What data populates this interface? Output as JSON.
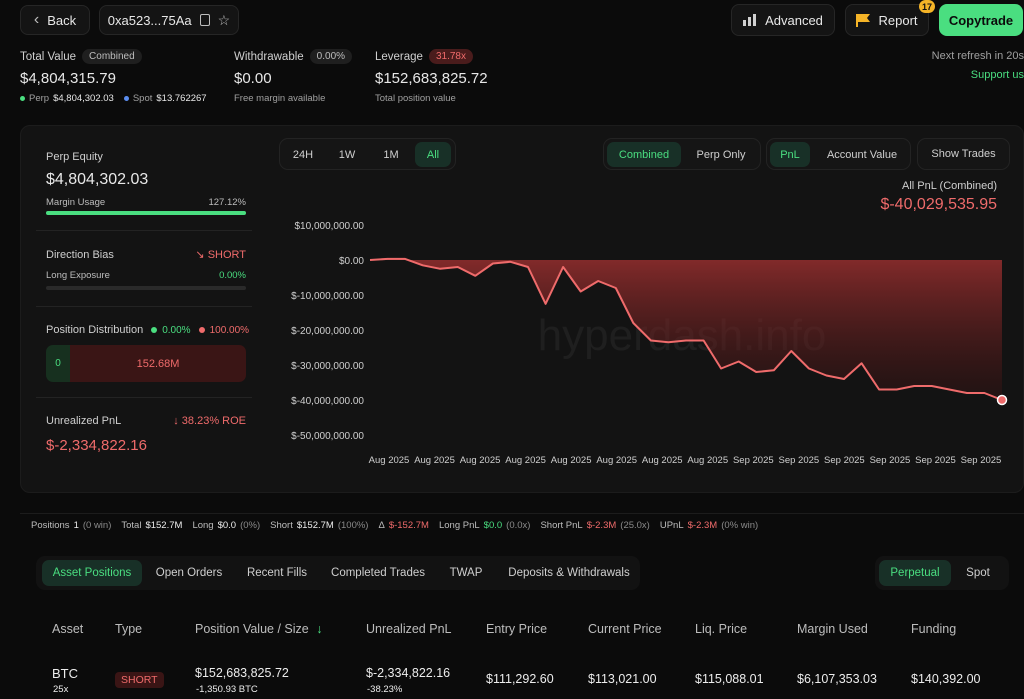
{
  "header": {
    "back_label": "Back",
    "address": "0xa523...75Aa",
    "advanced_label": "Advanced",
    "report_label": "Report",
    "report_badge": "17",
    "copytrade_label": "Copytrade",
    "refresh_text": "Next refresh in 20s",
    "support_text": "Support us"
  },
  "summary": {
    "total_value_label": "Total Value",
    "total_value_pill": "Combined",
    "total_value": "$4,804,315.79",
    "perp_label": "Perp",
    "perp_value": "$4,804,302.03",
    "spot_label": "Spot",
    "spot_value": "$13.762267",
    "withdrawable_label": "Withdrawable",
    "withdrawable_pill": "0.00%",
    "withdrawable_value": "$0.00",
    "withdrawable_sub": "Free margin available",
    "leverage_label": "Leverage",
    "leverage_pill": "31.78x",
    "leverage_value": "$152,683,825.72",
    "leverage_sub": "Total position value"
  },
  "left_panel": {
    "perp_equity_label": "Perp Equity",
    "perp_equity_value": "$4,804,302.03",
    "margin_usage_label": "Margin Usage",
    "margin_usage_value": "127.12%",
    "margin_usage_fraction": 1.0,
    "direction_bias_label": "Direction Bias",
    "direction_bias_value": "SHORT",
    "long_exposure_label": "Long Exposure",
    "long_exposure_value": "0.00%",
    "position_distribution_label": "Position Distribution",
    "dist_long_pct": "0.00%",
    "dist_short_pct": "100.00%",
    "dist_long_value": "0",
    "dist_short_value": "152.68M",
    "unrealized_pnl_label": "Unrealized PnL",
    "unrealized_roe": "38.23% ROE",
    "unrealized_pnl_value": "$-2,334,822.16"
  },
  "chart_controls": {
    "ranges": [
      "24H",
      "1W",
      "1M",
      "All"
    ],
    "active_range": "All",
    "modes": [
      "Combined",
      "Perp Only"
    ],
    "active_mode": "Combined",
    "metrics": [
      "PnL",
      "Account Value"
    ],
    "active_metric": "PnL",
    "show_trades_label": "Show Trades",
    "pnl_caption": "All PnL (Combined)",
    "pnl_total": "$-40,029,535.95",
    "watermark": "hyperdash.info"
  },
  "chart_data": {
    "type": "area",
    "series": [
      {
        "values": [
          0,
          0.3,
          0.3,
          -1.5,
          -2.5,
          -2,
          -4.5,
          -1,
          -0.5,
          -2,
          -12.5,
          -2,
          -9,
          -6,
          -8,
          -18,
          -23,
          -23.5,
          -23,
          -23,
          -31,
          -29,
          -32,
          -31.5,
          -26,
          -31,
          -33,
          -34,
          -29.5,
          -37,
          -37,
          -36,
          -36,
          -37,
          -38,
          -38,
          -40
        ]
      }
    ],
    "y_ticks": [
      "$10,000,000.00",
      "$0.00",
      "$-10,000,000.00",
      "$-20,000,000.00",
      "$-30,000,000.00",
      "$-40,000,000.00",
      "$-50,000,000.00"
    ],
    "x_ticks": [
      "Aug 2025",
      "Aug 2025",
      "Aug 2025",
      "Aug 2025",
      "Aug 2025",
      "Aug 2025",
      "Aug 2025",
      "Aug 2025",
      "Sep 2025",
      "Sep 2025",
      "Sep 2025",
      "Sep 2025",
      "Sep 2025",
      "Sep 2025"
    ],
    "ylim": [
      -50,
      10
    ],
    "y_unit": "millions USD",
    "grid": false,
    "color": "#ef6b6b"
  },
  "stats_bar": {
    "items": [
      {
        "label": "Positions",
        "value": "1",
        "extra": "(0 win)",
        "tone": "white"
      },
      {
        "label": "Total",
        "value": "$152.7M",
        "extra": "",
        "tone": "white"
      },
      {
        "label": "Long",
        "value": "$0.0",
        "extra": "(0%)",
        "tone": "white"
      },
      {
        "label": "Short",
        "value": "$152.7M",
        "extra": "(100%)",
        "tone": "white"
      },
      {
        "label": "Δ",
        "value": "$-152.7M",
        "extra": "",
        "tone": "red"
      },
      {
        "label": "Long PnL",
        "value": "$0.0",
        "extra": "(0.0x)",
        "tone": "green"
      },
      {
        "label": "Short PnL",
        "value": "$-2.3M",
        "extra": "(25.0x)",
        "tone": "red"
      },
      {
        "label": "UPnL",
        "value": "$-2.3M",
        "extra": "(0% win)",
        "tone": "red"
      }
    ]
  },
  "tabs": {
    "items": [
      "Asset Positions",
      "Open Orders",
      "Recent Fills",
      "Completed Trades",
      "TWAP",
      "Deposits & Withdrawals"
    ],
    "active": "Asset Positions",
    "market": [
      "Perpetual",
      "Spot"
    ],
    "active_market": "Perpetual"
  },
  "table": {
    "columns": [
      "Asset",
      "Type",
      "Position Value / Size",
      "Unrealized PnL",
      "Entry Price",
      "Current Price",
      "Liq. Price",
      "Margin Used",
      "Funding"
    ],
    "row": {
      "asset": "BTC",
      "leverage": "25x",
      "type": "SHORT",
      "position_value": "$152,683,825.72",
      "position_size": "-1,350.93 BTC",
      "unrealized_pnl": "$-2,334,822.16",
      "unrealized_pct": "-38.23%",
      "entry_price": "$111,292.60",
      "current_price": "$113,021.00",
      "liq_price": "$115,088.01",
      "margin_used": "$6,107,353.03",
      "funding": "$140,392.00"
    }
  },
  "colors": {
    "accent_green": "#4ade80",
    "loss_red": "#ef6b6b",
    "copytrade_bg": "#4ade80",
    "background": "#0b0b0b"
  }
}
